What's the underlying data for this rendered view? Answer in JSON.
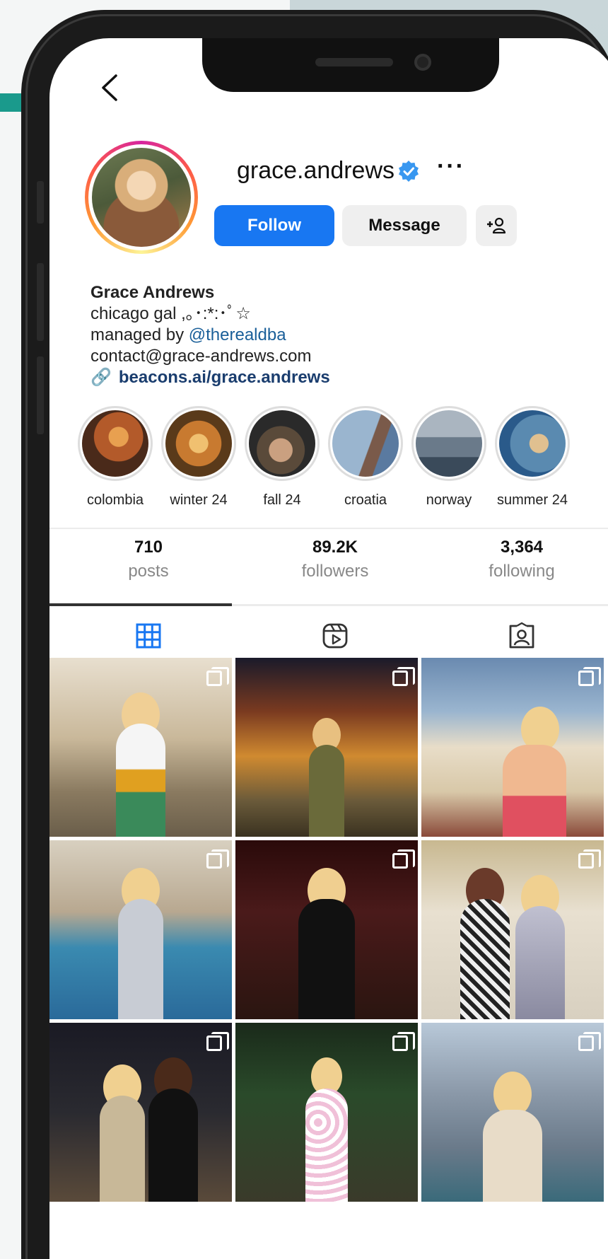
{
  "profile": {
    "username": "grace.andrews",
    "more_label": "···",
    "follow_label": "Follow",
    "message_label": "Message",
    "name": "Grace Andrews",
    "bio_line1": "chicago gal ,｡･:*:･ﾟ☆",
    "bio_managed_prefix": "managed by ",
    "bio_mention": "@therealdba",
    "bio_contact": "contact@grace-andrews.com",
    "bio_link_icon": "🔗",
    "bio_link": "beacons.ai/grace.andrews"
  },
  "highlights": [
    {
      "label": "colombia",
      "colors": [
        "#4a2a1a",
        "#b35a2a",
        "#e8a050"
      ]
    },
    {
      "label": "winter 24",
      "colors": [
        "#5a3a1a",
        "#c87a30",
        "#f0c070"
      ]
    },
    {
      "label": "fall 24",
      "colors": [
        "#2a2a2a",
        "#5a4a3a",
        "#caa080"
      ]
    },
    {
      "label": "croatia",
      "colors": [
        "#5a7aa0",
        "#9ab5cf",
        "#7a5a4a"
      ]
    },
    {
      "label": "norway",
      "colors": [
        "#3a4a5a",
        "#6a7a8a",
        "#aab5c0"
      ]
    },
    {
      "label": "summer 24",
      "colors": [
        "#2a5a8a",
        "#5a8ab0",
        "#e0c090"
      ]
    }
  ],
  "stats": [
    {
      "value": "710",
      "label": "posts"
    },
    {
      "value": "89.2K",
      "label": "followers"
    },
    {
      "value": "3,364",
      "label": "following"
    }
  ],
  "tabs": [
    "grid-icon",
    "reels-icon",
    "tagged-icon"
  ],
  "accent_blue": "#1877f2"
}
